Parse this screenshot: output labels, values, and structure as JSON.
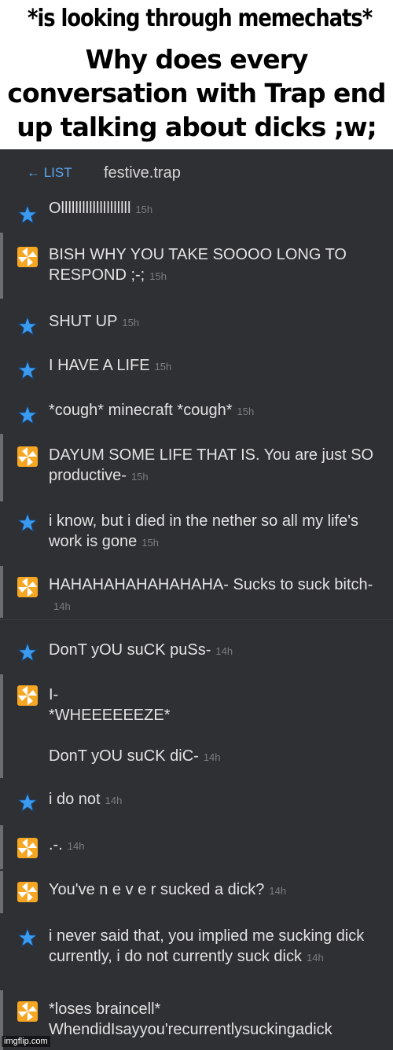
{
  "caption": {
    "line1": "*is looking through memechats*",
    "line2": "Why does every conversation with Trap end up talking about dicks ;w;"
  },
  "header": {
    "back_label": "← LIST",
    "title": "festive.trap"
  },
  "colors": {
    "background": "#2f3033",
    "accent": "#5aa8f0",
    "star": "#3a9bf0",
    "pinwheel_orange": "#f5a623",
    "pinwheel_white": "#ffffff"
  },
  "messages": [
    {
      "sender": "me",
      "avatar_icon": "star-icon",
      "text": "Ollllllllllllllllllll",
      "time": "15h"
    },
    {
      "sender": "other",
      "avatar_icon": "pinwheel-icon",
      "text": "BISH WHY YOU TAKE SOOOO LONG TO RESPOND ;-;",
      "time": "15h"
    },
    {
      "sender": "me",
      "avatar_icon": "star-icon",
      "text": "SHUT UP",
      "time": "15h"
    },
    {
      "sender": "me",
      "avatar_icon": "star-icon",
      "text": "I HAVE A LIFE",
      "time": "15h"
    },
    {
      "sender": "me",
      "avatar_icon": "star-icon",
      "text": "*cough* minecraft *cough*",
      "time": "15h"
    },
    {
      "sender": "other",
      "avatar_icon": "pinwheel-icon",
      "text": "DAYUM SOME LIFE THAT IS. You are just SO productive-",
      "time": "15h"
    },
    {
      "sender": "me",
      "avatar_icon": "star-icon",
      "text": "i know, but i died in the nether so all my life's work is gone",
      "time": "15h"
    },
    {
      "sender": "other",
      "avatar_icon": "pinwheel-icon",
      "text": "HAHAHAHAHAHAHAHA- Sucks to suck bitch-",
      "time": "14h"
    },
    {
      "sender": "me",
      "avatar_icon": "star-icon",
      "text": "DonT yOU suCK puSs-",
      "time": "14h"
    },
    {
      "sender": "other",
      "avatar_icon": "pinwheel-icon",
      "text": "I-\n*WHEEEEEEZE*\n\nDonT yOU suCK diC-",
      "time": "14h"
    },
    {
      "sender": "me",
      "avatar_icon": "star-icon",
      "text": "i do not",
      "time": "14h"
    },
    {
      "sender": "other",
      "avatar_icon": "pinwheel-icon",
      "text": ".-.",
      "time": "14h"
    },
    {
      "sender": "other",
      "avatar_icon": "pinwheel-icon",
      "text": "You've n e v e r sucked a dick?",
      "time": "14h"
    },
    {
      "sender": "me",
      "avatar_icon": "star-icon",
      "text": "i never said that, you implied me sucking dick currently, i do not currently suck dick",
      "time": "14h"
    },
    {
      "sender": "other",
      "avatar_icon": "pinwheel-icon",
      "text": "*loses braincell*\nWhendidIsayyou'recurrentlysuckingadick",
      "time": ""
    }
  ],
  "watermark": "imgflip.com"
}
